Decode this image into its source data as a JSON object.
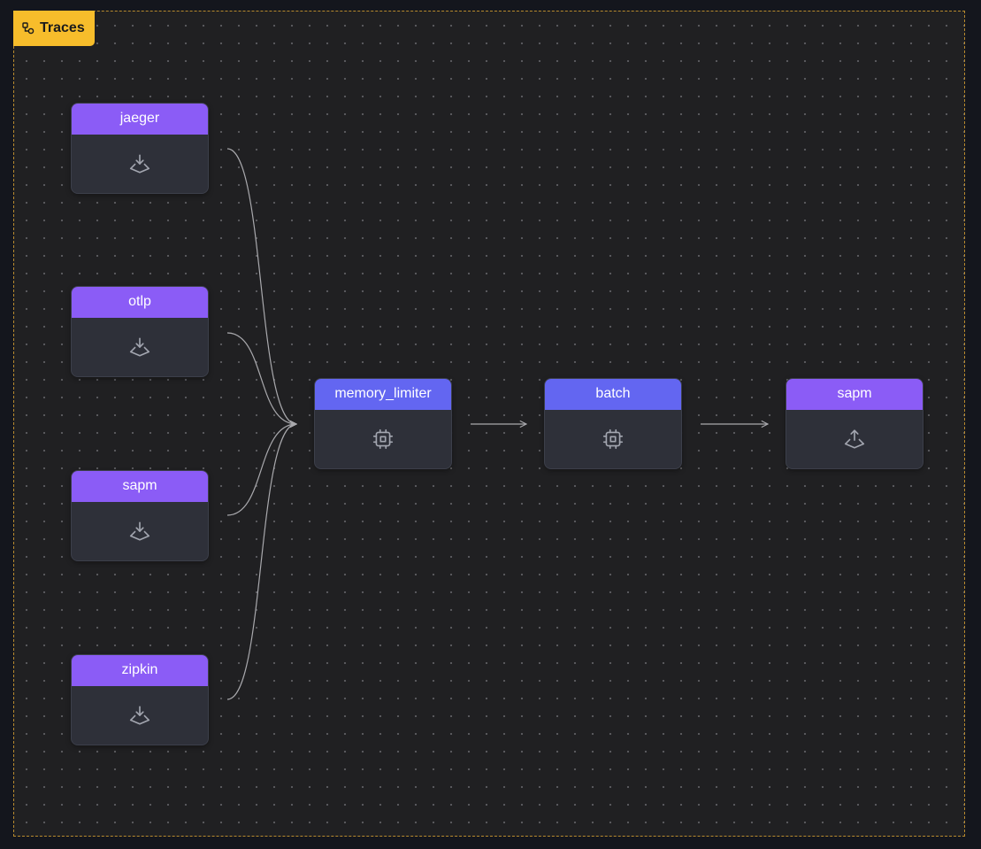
{
  "pipeline": {
    "title": "Traces",
    "badge_color": "#f7bd2b",
    "icon": "pipeline-icon"
  },
  "colors": {
    "receiver_header": "#8b5cf6",
    "processor_header": "#6366f1",
    "exporter_header": "#8b5cf6",
    "node_body": "#2e3039",
    "edge": "#a9a9ad"
  },
  "receivers": [
    {
      "label": "jaeger",
      "icon": "receive-icon"
    },
    {
      "label": "otlp",
      "icon": "receive-icon"
    },
    {
      "label": "sapm",
      "icon": "receive-icon"
    },
    {
      "label": "zipkin",
      "icon": "receive-icon"
    }
  ],
  "processors": [
    {
      "label": "memory_limiter",
      "icon": "processor-chip-icon"
    },
    {
      "label": "batch",
      "icon": "processor-chip-icon"
    }
  ],
  "exporters": [
    {
      "label": "sapm",
      "icon": "export-icon"
    }
  ]
}
